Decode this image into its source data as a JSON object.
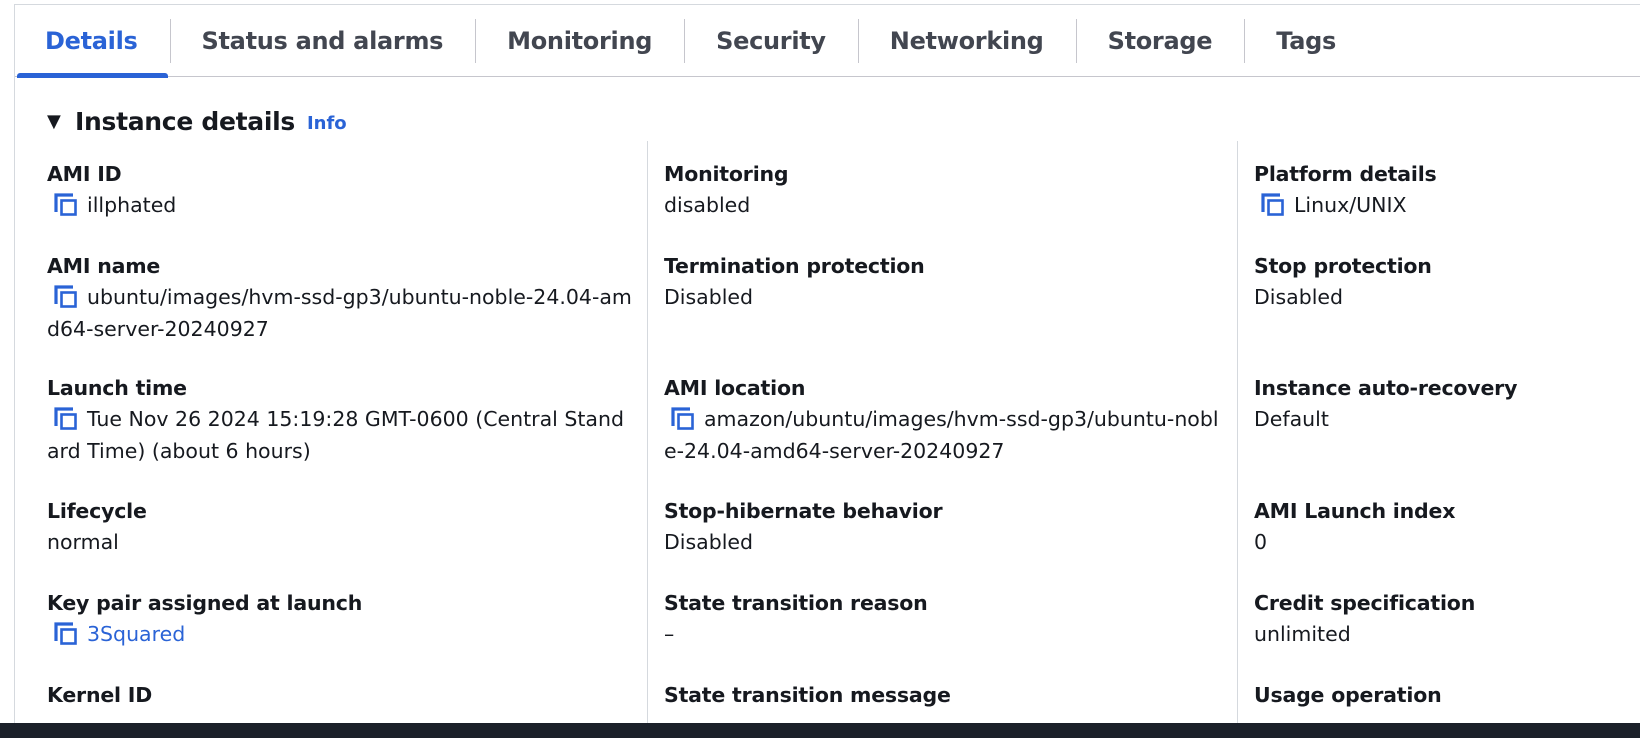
{
  "tabs": [
    {
      "label": "Details",
      "active": true
    },
    {
      "label": "Status and alarms"
    },
    {
      "label": "Monitoring"
    },
    {
      "label": "Security"
    },
    {
      "label": "Networking"
    },
    {
      "label": "Storage"
    },
    {
      "label": "Tags"
    }
  ],
  "section": {
    "title": "Instance details",
    "info_link": "Info",
    "caret_icon": "caret-down-icon"
  },
  "columns": [
    [
      {
        "label": "AMI ID",
        "value": "illphated",
        "copy": true
      },
      {
        "label": "AMI name",
        "value": "ubuntu/images/hvm-ssd-gp3/ubuntu-noble-24.04-amd64-server-20240927",
        "copy": true
      },
      {
        "label": "Launch time",
        "value": "Tue Nov 26 2024 15:19:28 GMT-0600 (Central Standard Time) (about 6 hours)",
        "copy": true
      },
      {
        "label": "Lifecycle",
        "value": "normal"
      },
      {
        "label": "Key pair assigned at launch",
        "value": "3Squared",
        "copy": true,
        "link": true
      },
      {
        "label": "Kernel ID",
        "value": ""
      }
    ],
    [
      {
        "label": "Monitoring",
        "value": "disabled"
      },
      {
        "label": "Termination protection",
        "value": "Disabled"
      },
      {
        "label": "AMI location",
        "value": "amazon/ubuntu/images/hvm-ssd-gp3/ubuntu-noble-24.04-amd64-server-20240927",
        "copy": true
      },
      {
        "label": "Stop-hibernate behavior",
        "value": "Disabled"
      },
      {
        "label": "State transition reason",
        "value": "–"
      },
      {
        "label": "State transition message",
        "value": ""
      }
    ],
    [
      {
        "label": "Platform details",
        "value": "Linux/UNIX",
        "copy": true
      },
      {
        "label": "Stop protection",
        "value": "Disabled"
      },
      {
        "label": "Instance auto-recovery",
        "value": "Default"
      },
      {
        "label": "AMI Launch index",
        "value": "0"
      },
      {
        "label": "Credit specification",
        "value": "unlimited"
      },
      {
        "label": "Usage operation",
        "value": ""
      }
    ]
  ],
  "colors": {
    "accent": "#2a63d6",
    "text": "#16191f",
    "tab_text": "#424650",
    "divider": "#d5d9de",
    "bottom_bar": "#1b2029"
  }
}
